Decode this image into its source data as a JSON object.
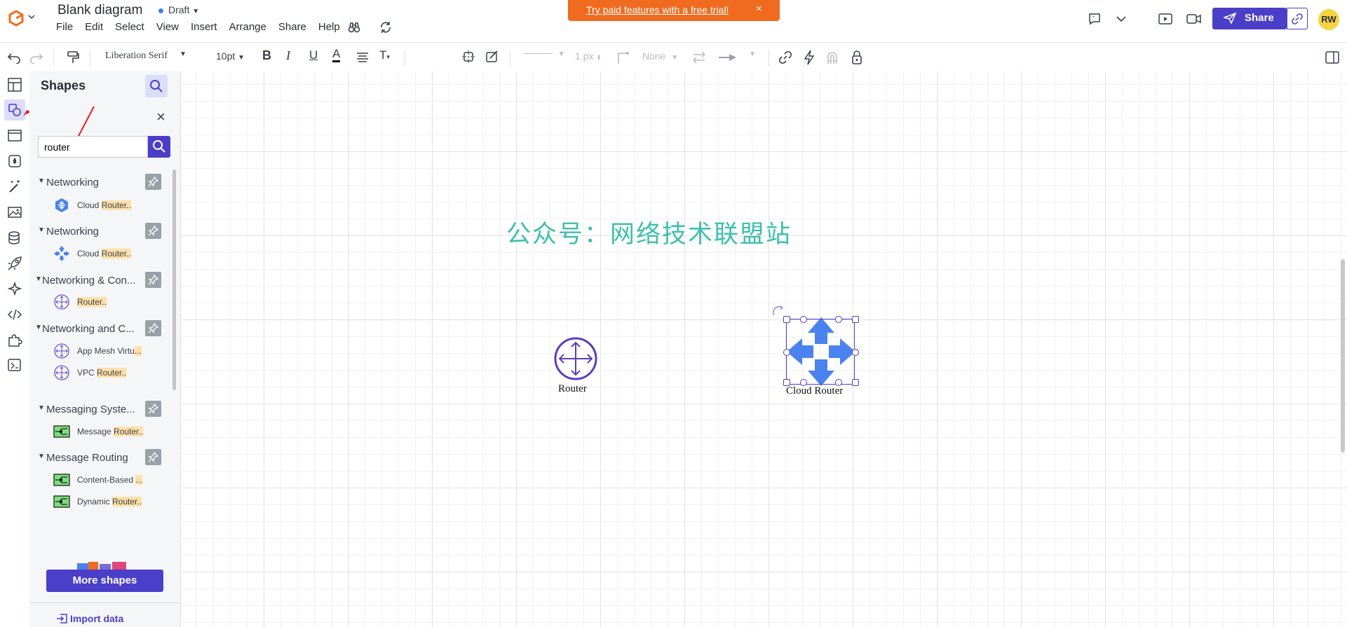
{
  "header": {
    "title": "Blank diagram",
    "draft_label": "Draft",
    "menu": [
      "File",
      "Edit",
      "Select",
      "View",
      "Insert",
      "Arrange",
      "Share",
      "Help"
    ],
    "promo_text": "Try paid features with a free trial!",
    "promo_close": "×",
    "share_label": "Share",
    "avatar_initials": "RW"
  },
  "toolbar": {
    "font_family": "Liberation Serif",
    "font_size": "10pt",
    "line_width": "1 px",
    "arrow_none": "None"
  },
  "panel": {
    "title": "Shapes",
    "search_value": "router",
    "close": "×",
    "groups": [
      {
        "name": "Networking",
        "items": [
          {
            "prefix": "Cloud ",
            "highlight": "Router..",
            "icon": "gcp-cloud-router-icon"
          }
        ]
      },
      {
        "name": "Networking",
        "items": [
          {
            "prefix": "Cloud ",
            "highlight": "Router..",
            "icon": "cloud-router-arrows-icon"
          }
        ]
      },
      {
        "name": "Networking & Con...",
        "items": [
          {
            "prefix": "",
            "highlight": "Router..",
            "icon": "aws-router-icon"
          }
        ]
      },
      {
        "name": "Networking and C...",
        "items": [
          {
            "prefix": "App Mesh Virtu",
            "highlight": "...",
            "icon": "aws-router-icon"
          },
          {
            "prefix": "VPC ",
            "highlight": "Router..",
            "icon": "aws-router-icon"
          }
        ]
      },
      {
        "name": "Messaging Syste...",
        "items": [
          {
            "prefix": "Message ",
            "highlight": "Router..",
            "icon": "message-router-icon"
          }
        ]
      },
      {
        "name": "Message Routing",
        "items": [
          {
            "prefix": "Content-Based ",
            "highlight": "...",
            "icon": "message-router-icon"
          },
          {
            "prefix": "Dynamic ",
            "highlight": "Router..",
            "icon": "message-router-icon"
          }
        ]
      }
    ],
    "more_shapes": "More shapes",
    "import_data": "Import data"
  },
  "canvas": {
    "watermark": "公众号：网络技术联盟站",
    "router_label": "Router",
    "cloud_router_label": "Cloud Router"
  },
  "colors": {
    "accent": "#4b3ec8",
    "promo": "#f06b1f",
    "router_purple": "#5a3fb8",
    "cloud_blue": "#4a82f0",
    "watermark": "#3dbfae"
  }
}
